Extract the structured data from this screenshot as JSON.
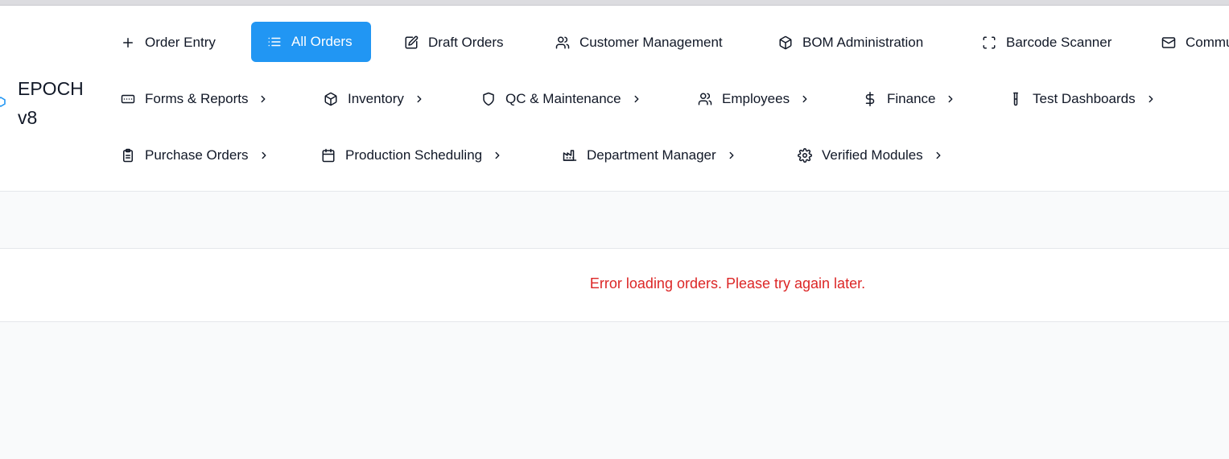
{
  "brand": {
    "name": "EPOCH v8"
  },
  "nav": {
    "row1": [
      {
        "label": "Order Entry",
        "icon": "plus-icon",
        "active": false
      },
      {
        "label": "All Orders",
        "icon": "list-icon",
        "active": true
      },
      {
        "label": "Draft Orders",
        "icon": "edit-icon",
        "active": false
      },
      {
        "label": "Customer Management",
        "icon": "users-icon",
        "active": false
      },
      {
        "label": "BOM Administration",
        "icon": "package-icon",
        "active": false
      },
      {
        "label": "Barcode Scanner",
        "icon": "scan-icon",
        "active": false
      },
      {
        "label": "Commu",
        "icon": "mail-icon",
        "active": false
      }
    ],
    "row2": [
      {
        "label": "Forms & Reports",
        "icon": "form-icon"
      },
      {
        "label": "Inventory",
        "icon": "package-icon"
      },
      {
        "label": "QC & Maintenance",
        "icon": "shield-icon"
      },
      {
        "label": "Employees",
        "icon": "users-icon"
      },
      {
        "label": "Finance",
        "icon": "dollar-icon"
      },
      {
        "label": "Test Dashboards",
        "icon": "test-tube-icon"
      }
    ],
    "row3": [
      {
        "label": "Purchase Orders",
        "icon": "clipboard-icon"
      },
      {
        "label": "Production Scheduling",
        "icon": "calendar-icon"
      },
      {
        "label": "Department Manager",
        "icon": "factory-icon"
      },
      {
        "label": "Verified Modules",
        "icon": "gear-icon"
      }
    ]
  },
  "orders": {
    "error": "Error loading orders. Please try again later."
  },
  "colors": {
    "accent": "#2196f3",
    "error": "#dc2626"
  }
}
